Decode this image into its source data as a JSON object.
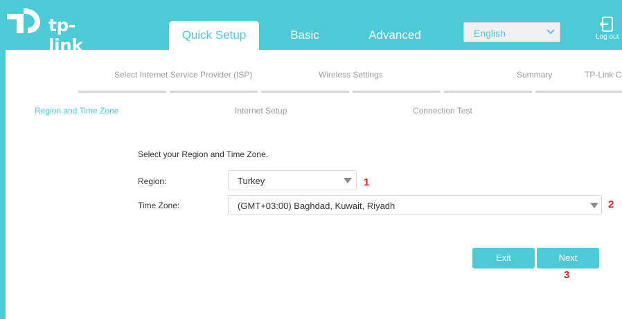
{
  "brand": {
    "name": "tp-link",
    "accent": "#4ccad6",
    "marker_color": "#d6242a"
  },
  "header": {
    "tabs": [
      {
        "label": "Quick Setup",
        "active": true
      },
      {
        "label": "Basic",
        "active": false
      },
      {
        "label": "Advanced",
        "active": false
      }
    ],
    "language": {
      "selected": "English",
      "icon": "chevron-down-icon"
    },
    "logout": {
      "label": "Log out",
      "icon": "logout-icon"
    }
  },
  "steps": {
    "top": [
      "Select Internet Service Provider (ISP)",
      "Wireless Settings",
      "Summary",
      "TP-Link C"
    ],
    "bottom": [
      "Region and Time Zone",
      "Internet Setup",
      "Connection Test"
    ],
    "active": "Region and Time Zone"
  },
  "form": {
    "prompt": "Select your Region and Time Zone.",
    "region": {
      "label": "Region:",
      "value": "Turkey",
      "marker": "1"
    },
    "timezone": {
      "label": "Time Zone:",
      "value": "(GMT+03:00) Baghdad, Kuwait, Riyadh",
      "marker": "2"
    }
  },
  "buttons": {
    "exit": "Exit",
    "next": "Next",
    "next_marker": "3"
  }
}
